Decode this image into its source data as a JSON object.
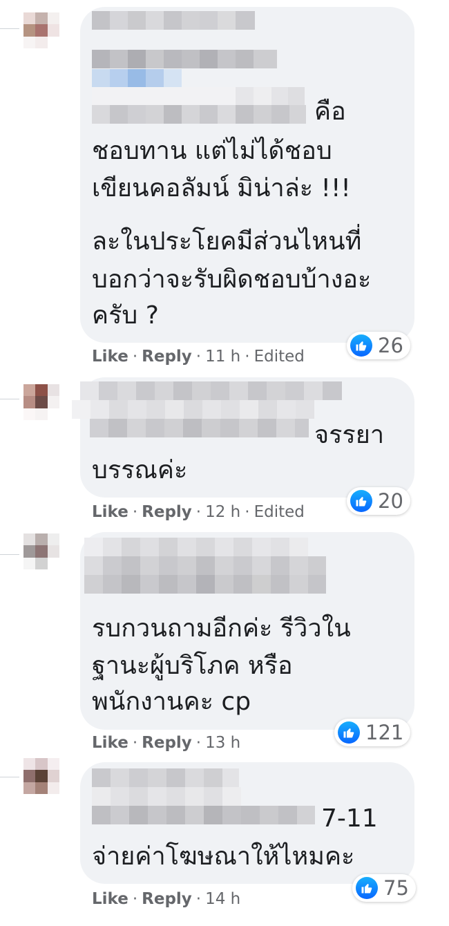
{
  "comments": [
    {
      "text_lines": [
        "คือ",
        "ชอบทาน แต่ไม่ได้ชอบ",
        "เขียนคอลัมน์ มิน่าล่ะ !!!",
        "ละในประโยคมีส่วนไหนที่",
        "บอกว่าจะรับผิดชอบบ้างอะ",
        "ครับ ?"
      ],
      "reaction_count": "26",
      "like_label": "Like",
      "reply_label": "Reply",
      "time": "11 h",
      "edited": "Edited",
      "avatar_colors": [
        "#e9d9d6",
        "#c5b2ad",
        "#f4f0ef",
        "#b59381",
        "#a9736f",
        "#efe3e3",
        "#f7f4f4",
        "#f3ecec",
        "#ffffff"
      ]
    },
    {
      "text_lines": [
        "จรรยา",
        "บรรณค่ะ"
      ],
      "reaction_count": "20",
      "like_label": "Like",
      "reply_label": "Reply",
      "time": "12 h",
      "edited": "Edited",
      "avatar_colors": [
        "#cba69b",
        "#8d5148",
        "#e8e2e3",
        "#b78d84",
        "#6c4b47",
        "#f4f1f1",
        "#fbf7f7",
        "#f6f3f3",
        "#ffffff"
      ]
    },
    {
      "text_lines": [
        "รบกวนถามอีกค่ะ รีวิวใน",
        "ฐานะผู้บริโภค หรือ",
        "พนักงานคะ cp"
      ],
      "reaction_count": "121",
      "like_label": "Like",
      "reply_label": "Reply",
      "time": "13 h",
      "avatar_colors": [
        "#e4e1e1",
        "#b9afad",
        "#eeeeee",
        "#9f9999",
        "#8d7575",
        "#e7e3e3",
        "#f5f5f5",
        "#d2d2d2",
        "#ffffff"
      ]
    },
    {
      "text_lines": [
        "7-11",
        "จ่ายค่าโฆษณาให้ไหมคะ"
      ],
      "reaction_count": "75",
      "like_label": "Like",
      "reply_label": "Reply",
      "time": "14 h",
      "avatar_colors": [
        "#eee4e6",
        "#d8c6c8",
        "#f5eef0",
        "#8f6f6d",
        "#5b4237",
        "#e0d2d2",
        "#c4a7a2",
        "#a48278",
        "#f3ecec"
      ]
    }
  ]
}
